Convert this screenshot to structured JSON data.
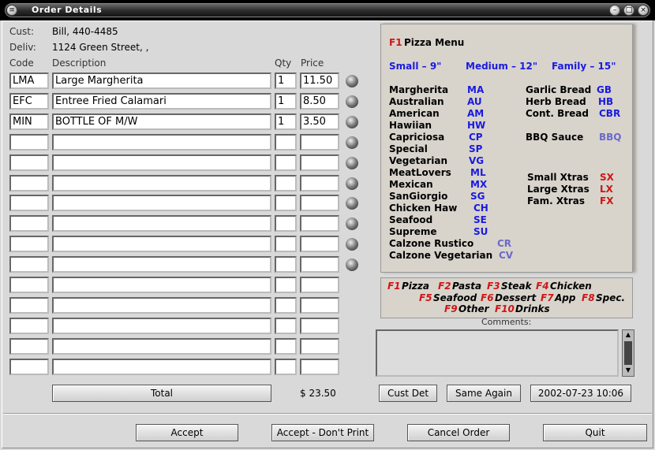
{
  "window": {
    "title": "Order Details"
  },
  "customer": {
    "cust_label": "Cust:",
    "cust_value": "Bill, 440-4485",
    "deliv_label": "Deliv:",
    "deliv_value": "1124 Green Street, ,"
  },
  "headers": {
    "code": "Code",
    "description": "Description",
    "qty": "Qty",
    "price": "Price"
  },
  "order_rows": [
    {
      "code": "LMA",
      "description": "Large Margherita",
      "qty": "1",
      "price": "11.50"
    },
    {
      "code": "EFC",
      "description": "Entree Fried Calamari",
      "qty": "1",
      "price": "8.50"
    },
    {
      "code": "MIN",
      "description": "BOTTLE OF M/W",
      "qty": "1",
      "price": "3.50"
    },
    {
      "code": "",
      "description": "",
      "qty": "",
      "price": ""
    },
    {
      "code": "",
      "description": "",
      "qty": "",
      "price": ""
    },
    {
      "code": "",
      "description": "",
      "qty": "",
      "price": ""
    },
    {
      "code": "",
      "description": "",
      "qty": "",
      "price": ""
    },
    {
      "code": "",
      "description": "",
      "qty": "",
      "price": ""
    },
    {
      "code": "",
      "description": "",
      "qty": "",
      "price": ""
    },
    {
      "code": "",
      "description": "",
      "qty": "",
      "price": ""
    },
    {
      "code": "",
      "description": "",
      "qty": "",
      "price": ""
    },
    {
      "code": "",
      "description": "",
      "qty": "",
      "price": ""
    },
    {
      "code": "",
      "description": "",
      "qty": "",
      "price": ""
    },
    {
      "code": "",
      "description": "",
      "qty": "",
      "price": ""
    },
    {
      "code": "",
      "description": "",
      "qty": "",
      "price": ""
    }
  ],
  "total": {
    "button": "Total",
    "amount": "$ 23.50"
  },
  "pizza_menu": {
    "key": "F1",
    "title": "Pizza Menu",
    "sizes": [
      "Small – 9\"",
      "Medium – 12\"",
      "Family – 15\""
    ],
    "pizzas": [
      {
        "name": "Margherita",
        "code": "MA"
      },
      {
        "name": "Australian",
        "code": "AU"
      },
      {
        "name": "American",
        "code": "AM"
      },
      {
        "name": "Hawiian",
        "code": "HW"
      },
      {
        "name": "Capriciosa",
        "code": "CP"
      },
      {
        "name": "Special",
        "code": "SP"
      },
      {
        "name": "Vegetarian",
        "code": "VG"
      },
      {
        "name": "MeatLovers",
        "code": "ML"
      },
      {
        "name": "Mexican",
        "code": "MX"
      },
      {
        "name": "SanGiorgio",
        "code": "SG"
      },
      {
        "name": "Chicken Haw",
        "code": "CH"
      },
      {
        "name": "Seafood",
        "code": "SE"
      },
      {
        "name": "Supreme",
        "code": "SU"
      },
      {
        "name": "Calzone Rustico",
        "code": "CR"
      },
      {
        "name": "Calzone Vegetarian",
        "code": "CV"
      }
    ],
    "breads": [
      {
        "name": "Garlic Bread",
        "code": "GB"
      },
      {
        "name": "Herb Bread",
        "code": "HB"
      },
      {
        "name": "Cont. Bread",
        "code": "CBR"
      }
    ],
    "sauce": {
      "name": "BBQ Sauce",
      "code": "BBQ"
    },
    "extras": [
      {
        "name": "Small Xtras",
        "code": "SX"
      },
      {
        "name": "Large Xtras",
        "code": "LX"
      },
      {
        "name": "Fam. Xtras",
        "code": "FX"
      }
    ]
  },
  "categories": [
    {
      "key": "F1",
      "name": "Pizza"
    },
    {
      "key": "F2",
      "name": "Pasta"
    },
    {
      "key": "F3",
      "name": "Steak"
    },
    {
      "key": "F4",
      "name": "Chicken"
    },
    {
      "key": "F5",
      "name": "Seafood"
    },
    {
      "key": "F6",
      "name": "Dessert"
    },
    {
      "key": "F7",
      "name": "App"
    },
    {
      "key": "F8",
      "name": "Spec."
    },
    {
      "key": "F9",
      "name": "Other"
    },
    {
      "key": "F10",
      "name": "Drinks"
    }
  ],
  "comments": {
    "label": "Comments:",
    "value": ""
  },
  "actions": {
    "cust_det": "Cust Det",
    "same_again": "Same Again",
    "datetime": "2002-07-23 10:06"
  },
  "footer": {
    "accept": "Accept",
    "accept_no_print": "Accept - Don't Print",
    "cancel": "Cancel Order",
    "quit": "Quit"
  },
  "colors": {
    "menu_bg": "#d8d4cc",
    "menu_blue": "#1a1adf",
    "menu_red": "#d01515",
    "titlebar": "#000000"
  }
}
